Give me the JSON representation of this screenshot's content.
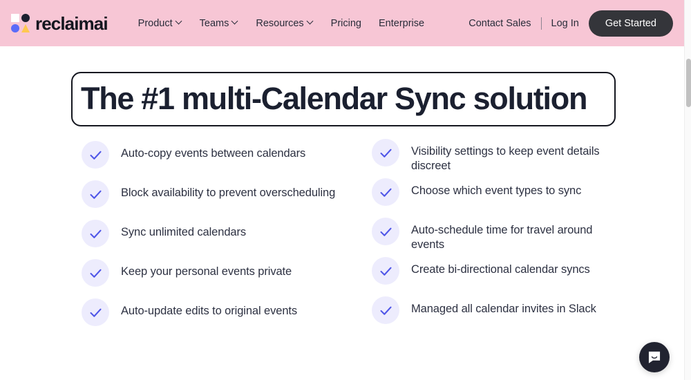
{
  "header": {
    "logo": {
      "word": "reclaimai",
      "shapes": {
        "square_color": "#ffffff",
        "circle_dark_color": "#1b2030",
        "circle_blue_color": "#5b6cf8",
        "triangle_color": "#ffc850"
      }
    },
    "background_color": "#f7c6d5",
    "nav_main": [
      {
        "label": "Product",
        "has_dropdown": true
      },
      {
        "label": "Teams",
        "has_dropdown": true
      },
      {
        "label": "Resources",
        "has_dropdown": true
      },
      {
        "label": "Pricing",
        "has_dropdown": false
      },
      {
        "label": "Enterprise",
        "has_dropdown": false
      }
    ],
    "nav_right": {
      "contact_sales": "Contact Sales",
      "log_in": "Log In",
      "get_started": "Get Started",
      "get_started_bg": "#34353a"
    }
  },
  "hero": {
    "title": "The #1 multi-Calendar Sync solution",
    "title_color": "#1b2030",
    "border_color": "#14161f"
  },
  "features": {
    "check_badge_bg": "#edecfd",
    "check_color": "#4f56e8",
    "left_column": [
      {
        "text": "Auto-copy events between calendars"
      },
      {
        "text": "Block availability to prevent overscheduling"
      },
      {
        "text": "Sync unlimited calendars"
      },
      {
        "text": "Keep your personal events private"
      },
      {
        "text": "Auto-update edits to original events"
      }
    ],
    "right_column": [
      {
        "text": "Visibility settings to keep event details discreet"
      },
      {
        "text": "Choose which event types to sync"
      },
      {
        "text": "Auto-schedule time for travel around events"
      },
      {
        "text": "Create bi-directional calendar syncs"
      },
      {
        "text": "Managed all calendar invites in Slack"
      }
    ]
  },
  "chat": {
    "icon": "chat-bubble-smile-icon",
    "background_color": "#212330"
  },
  "scrollbar": {
    "thumb_color": "#c1c1c1",
    "track_color": "#fafafa"
  }
}
